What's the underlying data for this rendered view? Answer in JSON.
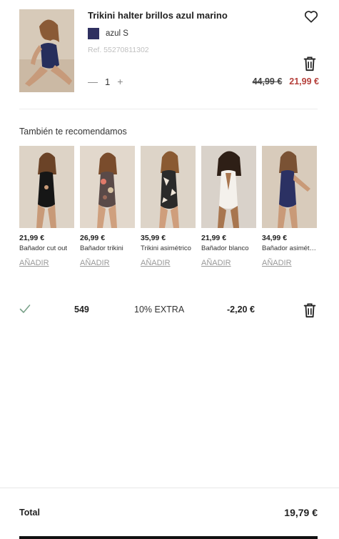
{
  "cart_item": {
    "title": "Trikini halter brillos azul marino",
    "variant": "azul S",
    "ref": "Ref. 55270811302",
    "quantity": "1",
    "minus_symbol": "—",
    "plus_symbol": "+",
    "old_price": "44,99 €",
    "new_price": "21,99 €",
    "swatch_color": "#2f3060",
    "icons": [
      "heart-icon",
      "trash-icon",
      "minus-icon",
      "plus-icon"
    ]
  },
  "recommendations": {
    "title": "También te recomendamos",
    "add_label": "AÑADIR",
    "items": [
      {
        "price": "21,99 €",
        "name": "Bañador cut out"
      },
      {
        "price": "26,99 €",
        "name": "Bañador trikini"
      },
      {
        "price": "35,99 €",
        "name": "Trikini asimétrico"
      },
      {
        "price": "21,99 €",
        "name": "Bañador blanco"
      },
      {
        "price": "34,99 €",
        "name": "Bañador asimétrico"
      }
    ]
  },
  "promo": {
    "points": "549",
    "label": "10% EXTRA",
    "amount": "-2,20 €",
    "icons": [
      "check-icon",
      "trash-icon"
    ]
  },
  "total": {
    "label": "Total",
    "value": "19,79 €"
  },
  "colors": {
    "sale_price": "#b5403b",
    "swatch": "#2f3060",
    "check": "#7aa28a"
  }
}
